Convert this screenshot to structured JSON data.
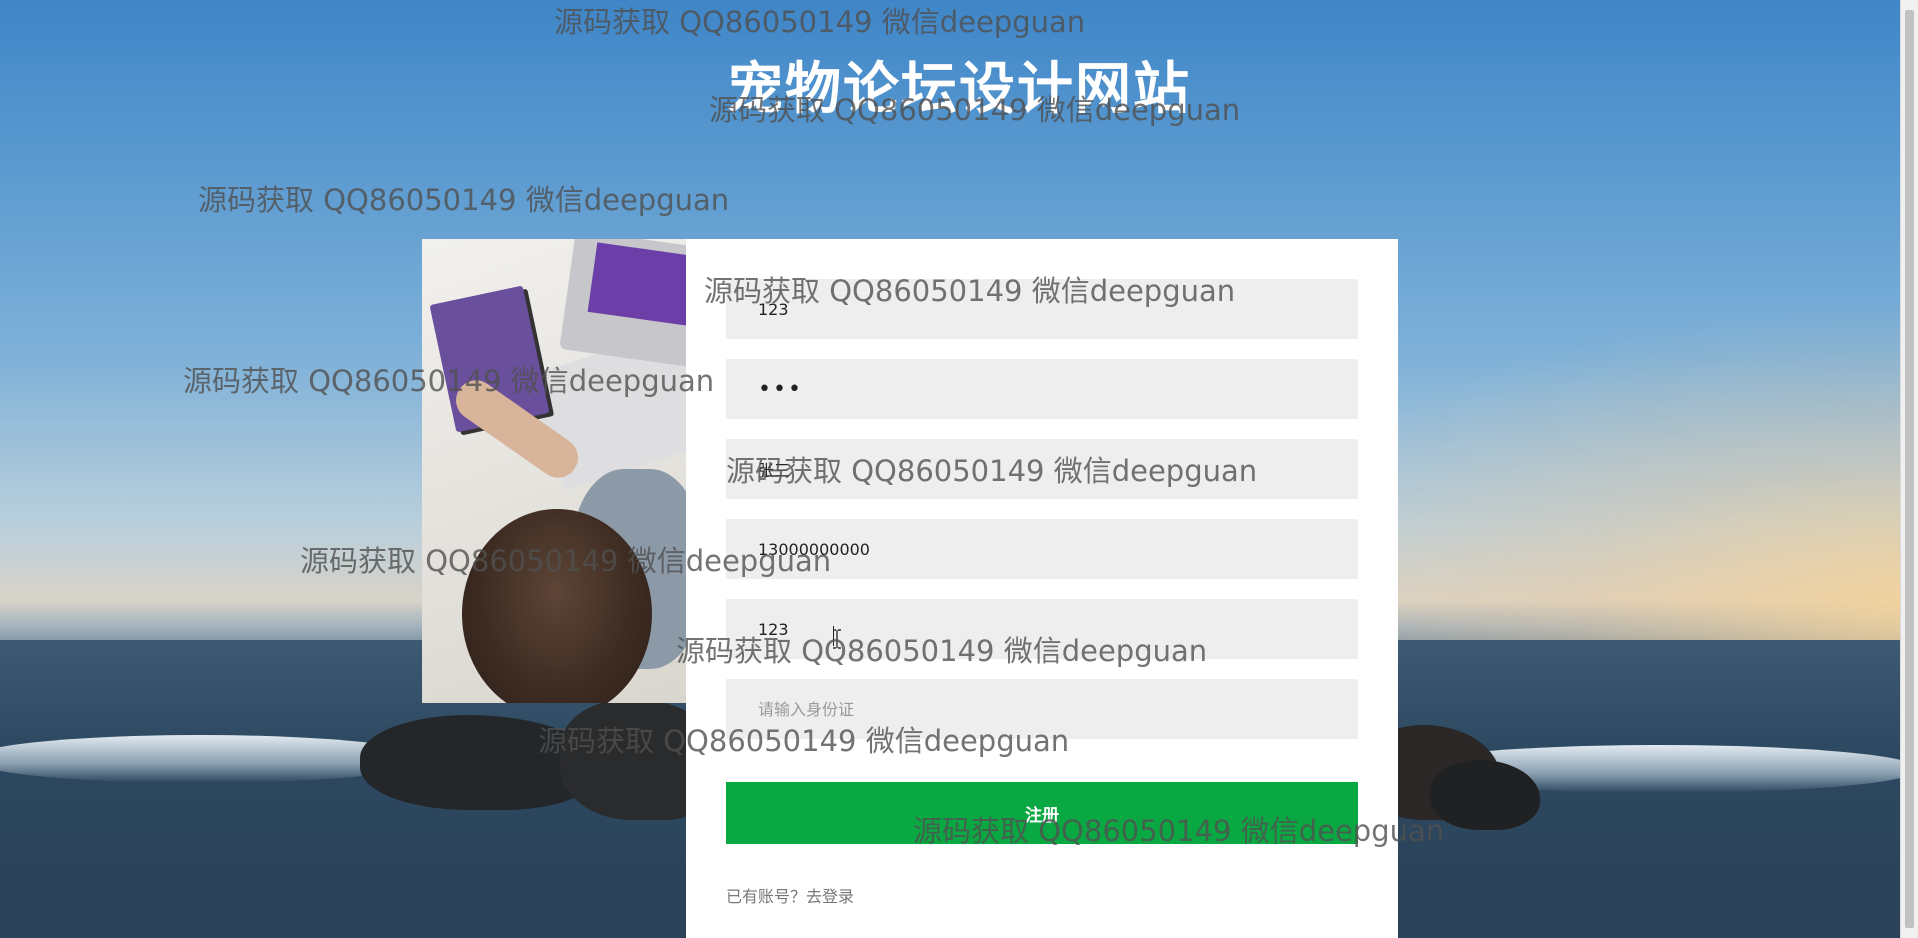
{
  "site": {
    "title": "宠物论坛设计网站"
  },
  "form": {
    "username": {
      "value": "123",
      "placeholder": ""
    },
    "password": {
      "value": "123",
      "placeholder": ""
    },
    "realname": {
      "value": "张三",
      "placeholder": ""
    },
    "phone": {
      "value": "13000000000",
      "placeholder": ""
    },
    "email": {
      "value": "123",
      "placeholder": ""
    },
    "idcard": {
      "value": "",
      "placeholder": "请输入身份证"
    },
    "register_label": "注册",
    "login_link": "已有账号？去登录"
  },
  "watermarks": [
    "源码获取 QQ86050149 微信deepguan",
    "源码获取 QQ86050149 微信deepguan",
    "源码获取 QQ86050149 微信deepguan",
    "源码获取 QQ86050149 微信deepguan",
    "源码获取 QQ86050149 微信deepguan",
    "源码获取 QQ86050149 微信deepguan",
    "源码获取 QQ86050149 微信deepguan",
    "源码获取 QQ86050149 微信deepguan",
    "源码获取 QQ86050149 微信deepguan",
    "源码获取 QQ86050149 微信deepguan"
  ],
  "colors": {
    "accent": "#0aa843",
    "field_bg": "#eeeeee",
    "card_bg": "#ffffff"
  },
  "icons": {
    "cursor": "ibeam-cursor-icon"
  }
}
